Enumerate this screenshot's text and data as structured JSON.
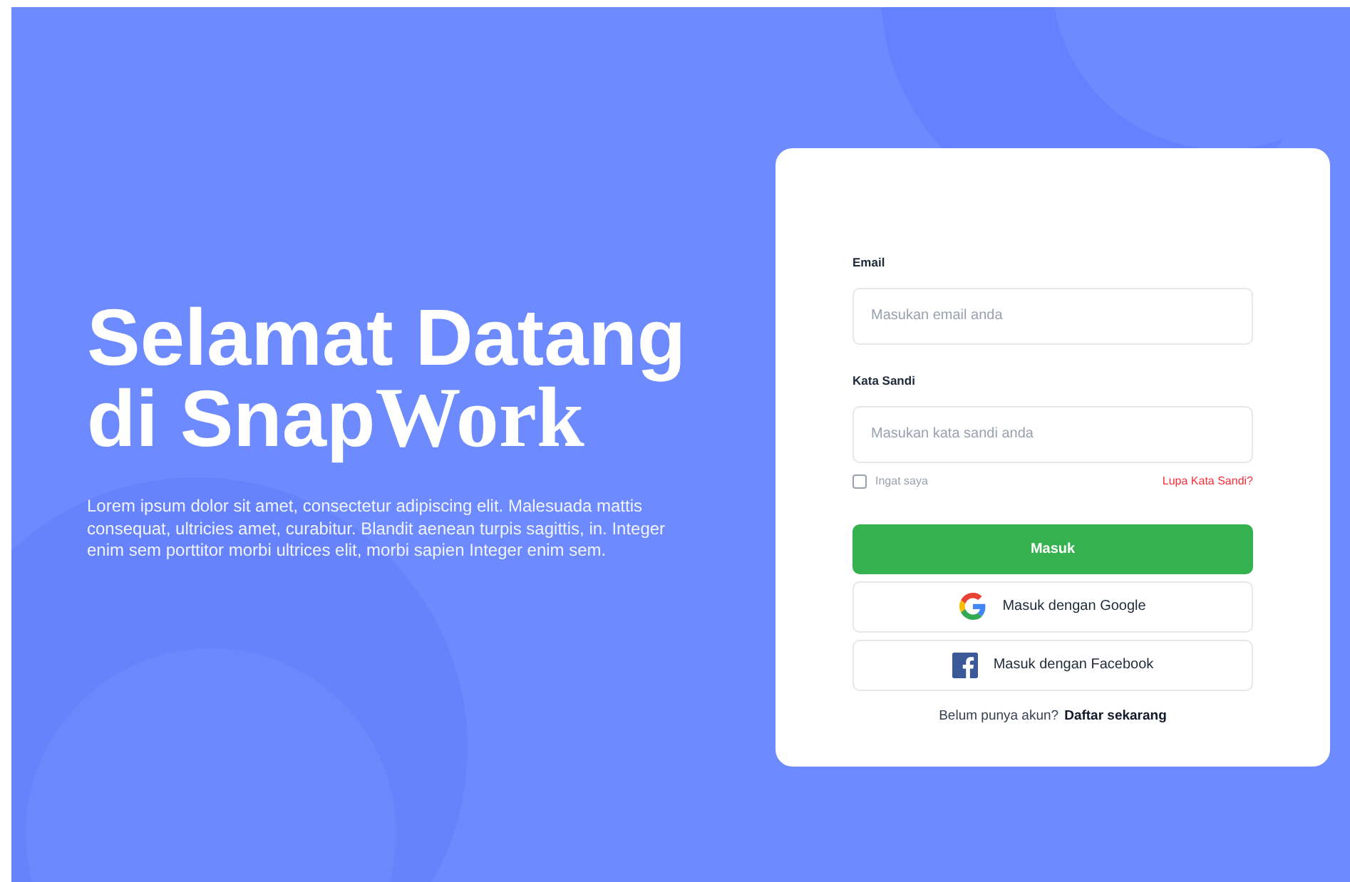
{
  "hero": {
    "heading": [
      [
        {
          "text": "Selamat Datang",
          "kind": "sans"
        }
      ],
      [
        {
          "text": "di Snap",
          "kind": "sans"
        },
        {
          "text": "Work",
          "kind": "serif"
        }
      ]
    ],
    "description": "Lorem ipsum dolor sit amet, consectetur adipiscing elit. Malesuada mattis consequat, ultricies amet, curabitur. Blandit aenean turpis sagittis, in. Integer enim sem porttitor morbi ultrices elit, morbi sapien Integer enim sem."
  },
  "login": {
    "fields": [
      {
        "label": "Email",
        "placeholder": "Masukan email anda"
      },
      {
        "label": "Kata Sandi",
        "placeholder": "Masukan kata sandi anda"
      }
    ],
    "remember": {
      "label": "Ingat saya",
      "checked": false
    },
    "forgot_link": "Lupa Kata Sandi?",
    "buttons": [
      {
        "label": "Masuk",
        "kind": "primary"
      },
      {
        "label": "Masuk dengan Google",
        "kind": "google"
      },
      {
        "label": "Masuk dengan Facebook",
        "kind": "facebook"
      }
    ],
    "signup": {
      "prompt": "Belum punya akun?",
      "link": "Daftar sekarang"
    }
  }
}
